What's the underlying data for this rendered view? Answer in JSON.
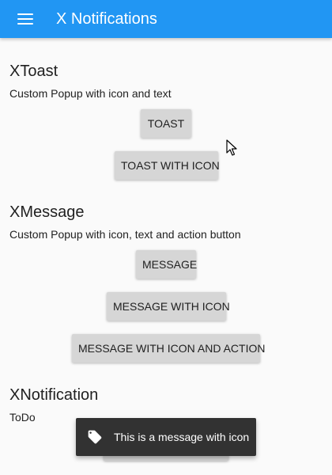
{
  "appbar": {
    "title": "X Notifications",
    "menu_icon": "hamburger-menu-icon",
    "color": "#2196f3"
  },
  "sections": {
    "toast": {
      "title": "XToast",
      "description": "Custom Popup with icon and text",
      "buttons": [
        "TOAST",
        "TOAST WITH ICON"
      ]
    },
    "message": {
      "title": "XMessage",
      "description": "Custom Popup with icon, text and action button",
      "buttons": [
        "MESSAGE",
        "MESSAGE WITH ICON",
        "MESSAGE WITH ICON AND ACTION"
      ]
    },
    "notification": {
      "title": "XNotification",
      "description": "ToDo"
    }
  },
  "snackbar": {
    "icon": "tag-icon",
    "text": "This is a message with icon",
    "background": "#323232"
  },
  "colors": {
    "background": "#fafafa",
    "button": "#d6d6d6",
    "text": "#212121"
  }
}
